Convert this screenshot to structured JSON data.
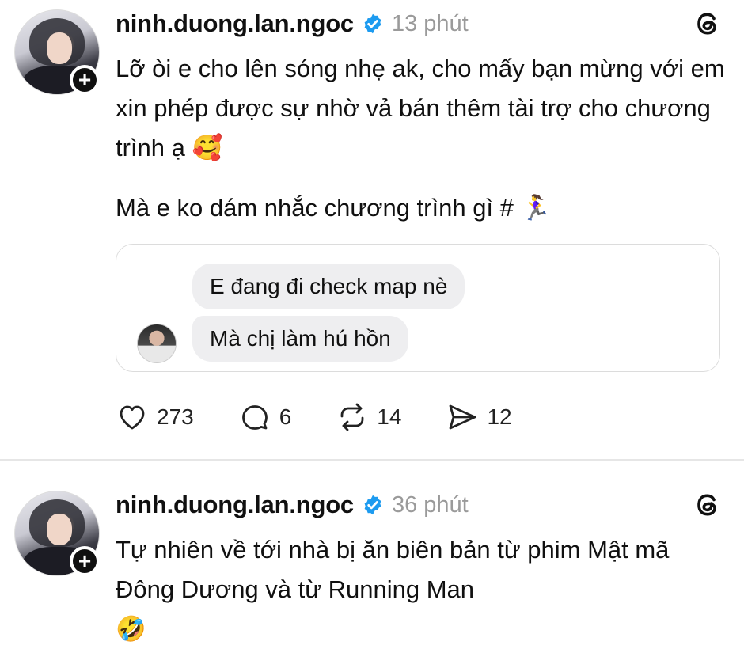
{
  "posts": [
    {
      "username": "ninh.duong.lan.ngoc",
      "time": "13 phút",
      "paragraphs": [
        "Lỡ òi e cho lên sóng nhẹ ak, cho mấy bạn mừng với em xin phép được sự nhờ vả bán thêm tài trợ cho chương trình ạ 🥰",
        "Mà e ko dám nhắc chương trình gì # 🏃‍♀️"
      ],
      "quote": {
        "messages": [
          "E đang đi check map nè",
          "Mà chị làm hú hồn"
        ]
      },
      "actions": {
        "likes": "273",
        "comments": "6",
        "reposts": "14",
        "shares": "12"
      }
    },
    {
      "username": "ninh.duong.lan.ngoc",
      "time": "36 phút",
      "paragraphs": [
        "Tự nhiên về tới nhà bị ăn biên bản từ phim Mật mã Đông Dương  và từ Running Man",
        "🤣"
      ]
    }
  ],
  "colors": {
    "verified": "#1d9bf0",
    "muted_text": "#9a9a9a",
    "bubble_bg": "#eeeef0"
  }
}
